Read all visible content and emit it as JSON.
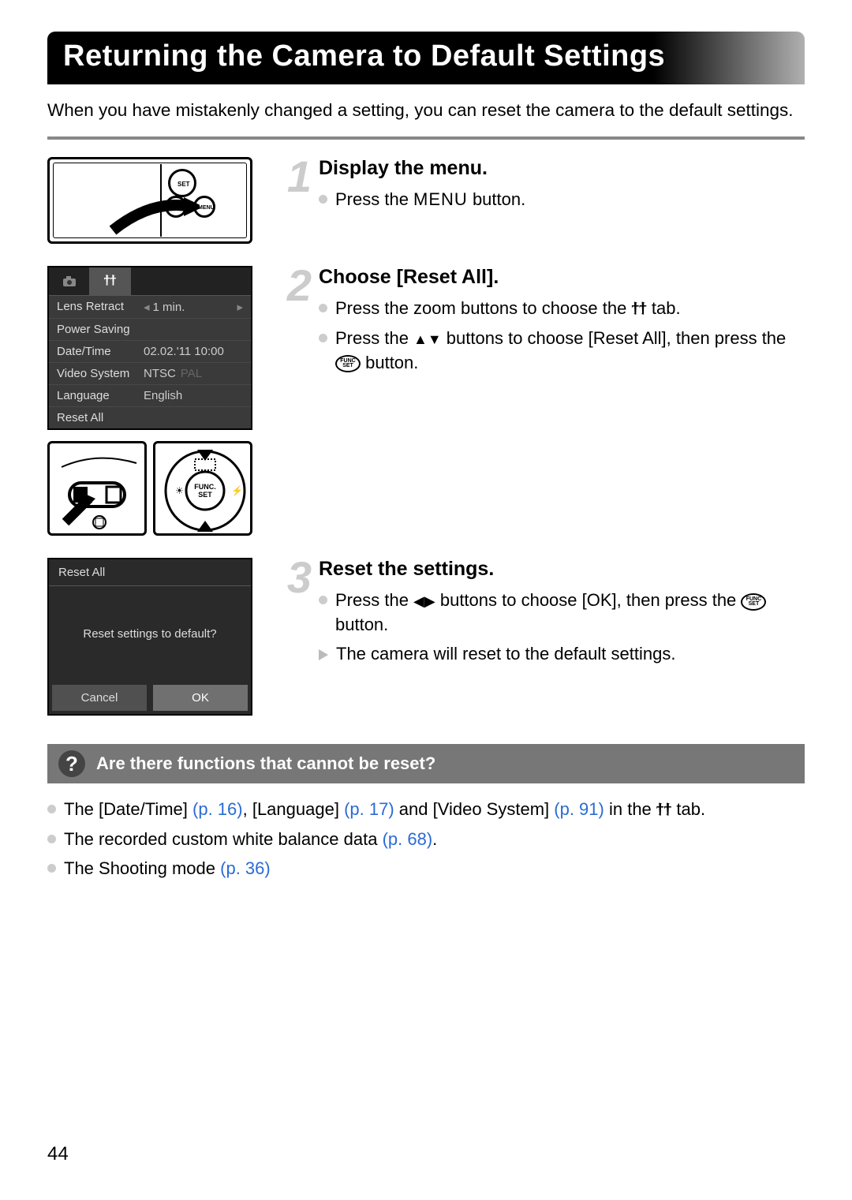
{
  "title": "Returning the Camera to Default Settings",
  "intro": "When you have mistakenly changed a setting, you can reset the camera to the default settings.",
  "steps": {
    "s1": {
      "num": "1",
      "title": "Display the menu.",
      "line1_a": "Press the ",
      "menu_word": "MENU",
      "line1_b": " button."
    },
    "s2": {
      "num": "2",
      "title": "Choose [Reset All].",
      "line1_a": "Press the zoom buttons to choose the ",
      "line1_b": " tab.",
      "line2_a": "Press the ",
      "line2_b": " buttons to choose [Reset All], then press the ",
      "line2_c": " button."
    },
    "s3": {
      "num": "3",
      "title": "Reset the settings.",
      "line1_a": "Press the ",
      "line1_b": " buttons to choose [OK], then press the ",
      "line1_c": " button.",
      "line2": "The camera will reset to the default settings."
    }
  },
  "menu_shot": {
    "rows": [
      {
        "label": "Lens Retract",
        "val": "1 min.",
        "arrows": true
      },
      {
        "label": "Power Saving",
        "val": ""
      },
      {
        "label": "Date/Time",
        "val": "02.02.'11 10:00"
      },
      {
        "label": "Video System",
        "val": "NTSC",
        "dim": "PAL"
      },
      {
        "label": "Language",
        "val": "English"
      },
      {
        "label": "Reset All",
        "val": ""
      }
    ]
  },
  "reset_dialog": {
    "header": "Reset All",
    "message": "Reset settings to default?",
    "cancel": "Cancel",
    "ok": "OK"
  },
  "note": {
    "heading": "Are there functions that cannot be reset?",
    "b1_a": "The [Date/Time] ",
    "b1_p1": "(p. 16)",
    "b1_b": ", [Language] ",
    "b1_p2": "(p. 17)",
    "b1_c": " and [Video System] ",
    "b1_p3": "(p. 91)",
    "b1_d": " in the ",
    "b1_e": " tab.",
    "b2_a": "The recorded custom white balance data ",
    "b2_p": "(p. 68)",
    "b2_b": ".",
    "b3_a": "The Shooting mode ",
    "b3_p": "(p. 36)"
  },
  "func_label_top": "FUNC",
  "func_label_bot": "SET",
  "page_number": "44"
}
